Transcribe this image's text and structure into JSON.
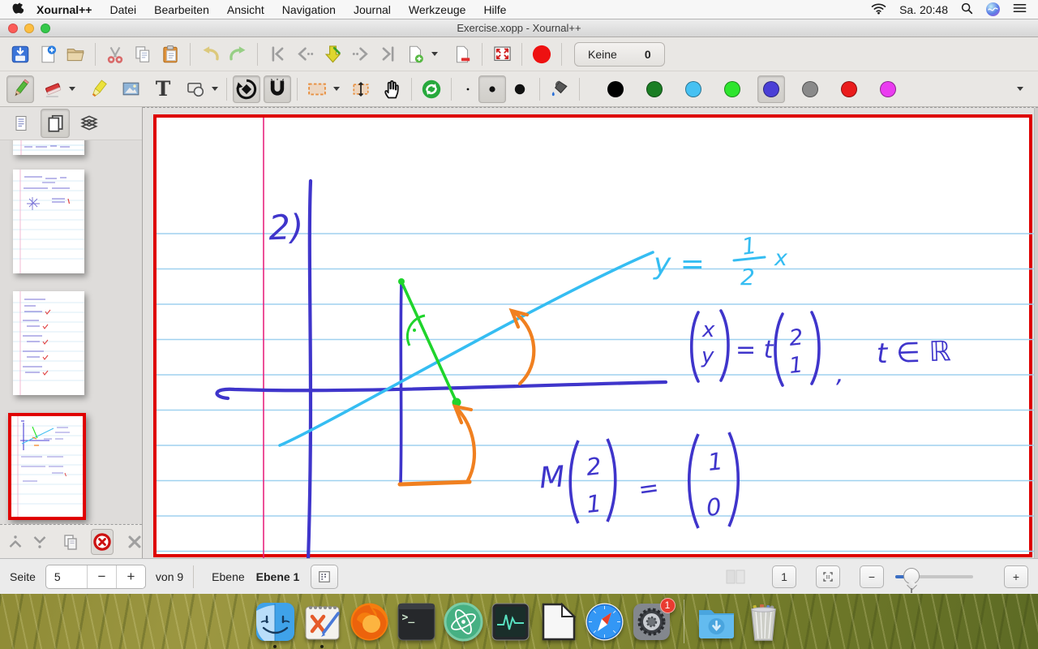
{
  "menubar": {
    "items": [
      "Xournal++",
      "Datei",
      "Bearbeiten",
      "Ansicht",
      "Navigation",
      "Journal",
      "Werkzeuge",
      "Hilfe"
    ],
    "time": "Sa. 20:48"
  },
  "window": {
    "title": "Exercise.xopp - Xournal++"
  },
  "toolbar": {
    "audio_device_label": "Keine",
    "audio_count": "0",
    "text_tool_glyph": "T"
  },
  "statusbar": {
    "page_label": "Seite",
    "page_value": "5",
    "decrement": "−",
    "increment": "+",
    "page_total": "von 9",
    "layer_label": "Ebene",
    "layer_value": "Ebene 1",
    "zoom_original": "1",
    "zoom_out": "−",
    "zoom_in": "+"
  },
  "canvas": {
    "exercise_label": "2)",
    "line_label": {
      "lhs": "y =",
      "numerator": "1",
      "denominator": "2",
      "variable": "x"
    },
    "vector_equation": {
      "lhs_top": "x",
      "lhs_bottom": "y",
      "middle": "= t",
      "rhs_top": "2",
      "rhs_bottom": "1",
      "comma": ",",
      "condition": "t ∈ ℝ"
    },
    "mapping_equation": {
      "operator": "M",
      "arg_top": "2",
      "arg_bottom": "1",
      "equals": "=",
      "result_top": "1",
      "result_bottom": "0"
    }
  },
  "dock": {
    "badge_count": "1",
    "terminal_glyph": ">_"
  },
  "icons": {
    "menubar": [
      "apple",
      "wifi",
      "spotlight-search",
      "siri",
      "notification-center"
    ],
    "dock": [
      "finder",
      "xournalpp",
      "firefox",
      "terminal",
      "atom",
      "activity-monitor",
      "libreoffice",
      "safari",
      "system-preferences",
      "downloads-folder",
      "trash"
    ]
  },
  "colors": {
    "page_border": "#de0000",
    "ruling": "#9fd1ef",
    "margin_line": "#e8247e",
    "ink_blue": "#3f35cb",
    "ink_cyan": "#35bdf2",
    "ink_green": "#1fd42c",
    "ink_orange": "#f08020",
    "palette": [
      "#000000",
      "#1b7e24",
      "#46c1f2",
      "#2ee52e",
      "#4a3fd6",
      "#8a8a8a",
      "#ea1c1c",
      "#ea3cf0"
    ]
  }
}
